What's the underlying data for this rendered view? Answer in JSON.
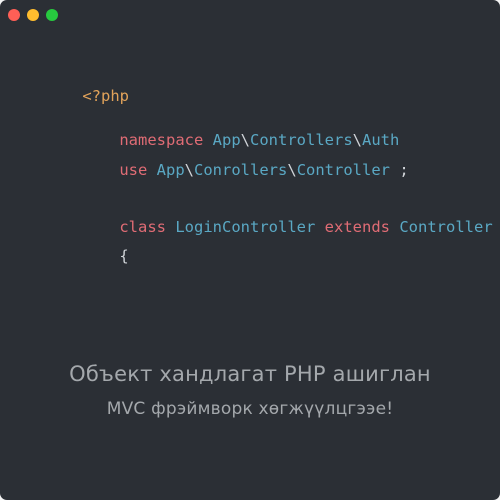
{
  "window": {
    "controls": [
      {
        "name": "close",
        "color": "#ff5f56"
      },
      {
        "name": "minimize",
        "color": "#ffbd2e"
      },
      {
        "name": "maximize",
        "color": "#27c93f"
      }
    ]
  },
  "colors": {
    "background": "#2b2f35",
    "php_tag": "#e2a35a",
    "keyword": "#e06c75",
    "identifier": "#5aa8c4",
    "punctuation": "#d0d4d8",
    "caption": "#a4a8ac"
  },
  "code": {
    "open_tag": "<?php",
    "namespace_line": {
      "keyword": "namespace",
      "segments": [
        "App",
        "\\",
        "Controllers",
        "\\",
        "Auth"
      ]
    },
    "use_line": {
      "keyword": "use",
      "segments": [
        "App",
        "\\",
        "Conrollers",
        "\\",
        "Controller"
      ],
      "terminator": ";"
    },
    "class_line": {
      "keyword": "class",
      "class_name": "LoginController",
      "extends_keyword": "extends",
      "parent": "Controller"
    },
    "brace": "{"
  },
  "caption": {
    "line1": "Объект хандлагат PHP ашиглан",
    "line2": "MVC фрэймворк хөгжүүлцгээе!"
  }
}
